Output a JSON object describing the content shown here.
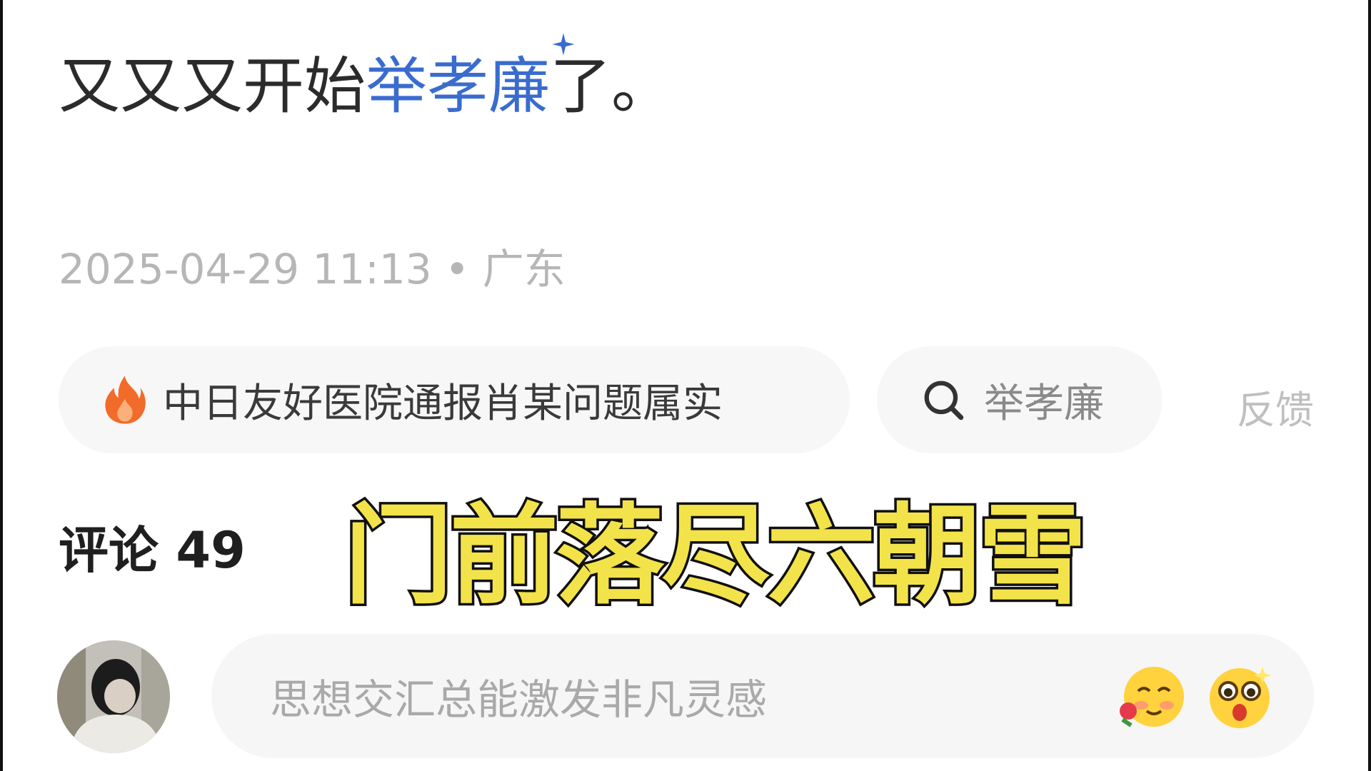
{
  "post": {
    "text_before": "又又又开始",
    "link_text": "举孝廉",
    "text_after": "了。"
  },
  "meta": {
    "datetime": "2025-04-29 11:13",
    "separator": "•",
    "location": "广东"
  },
  "chips": {
    "hot_topic": "中日友好医院通报肖某问题属实",
    "search_term": "举孝廉",
    "feedback": "反馈"
  },
  "comments": {
    "label": "评论",
    "count": "49"
  },
  "caption": "门前落尽六朝雪",
  "comment_input": {
    "placeholder": "思想交汇总能激发非凡灵感"
  },
  "icons": {
    "hot": "fire-icon",
    "search": "search-icon",
    "link_marker": "sparkle-icon",
    "emoji_1": "blushing-rose-emoji",
    "emoji_2": "surprised-emoji"
  },
  "colors": {
    "link": "#3a6ccf",
    "caption_fill": "#f3e34a",
    "fire": "#f26b2a"
  }
}
